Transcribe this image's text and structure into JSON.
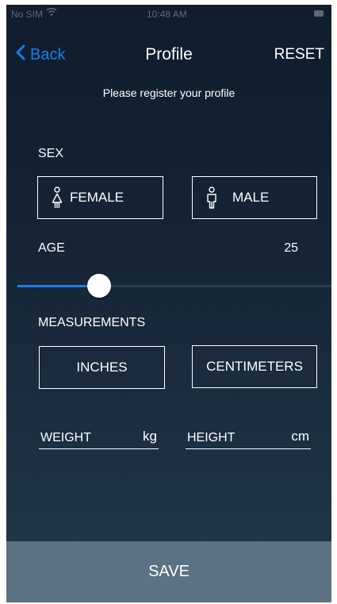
{
  "status_bar": {
    "carrier": "No SIM",
    "time": "10:48 AM"
  },
  "nav": {
    "back_label": "Back",
    "title": "Profile",
    "reset_label": "RESET"
  },
  "subtitle": "Please register your profile",
  "sex": {
    "label": "SEX",
    "female_label": "FEMALE",
    "male_label": "MALE"
  },
  "age": {
    "label": "AGE",
    "value": "25",
    "slider_fraction": 0.26
  },
  "measurements": {
    "label": "MEASUREMENTS",
    "inches_label": "INCHES",
    "centimeters_label": "CENTIMETERS"
  },
  "weight": {
    "placeholder": "WEIGHT",
    "unit": "kg"
  },
  "height": {
    "placeholder": "HEIGHT",
    "unit": "cm"
  },
  "save_label": "SAVE",
  "colors": {
    "accent": "#1f7bea",
    "save_bar": "#5c7282",
    "background": "#152536"
  }
}
